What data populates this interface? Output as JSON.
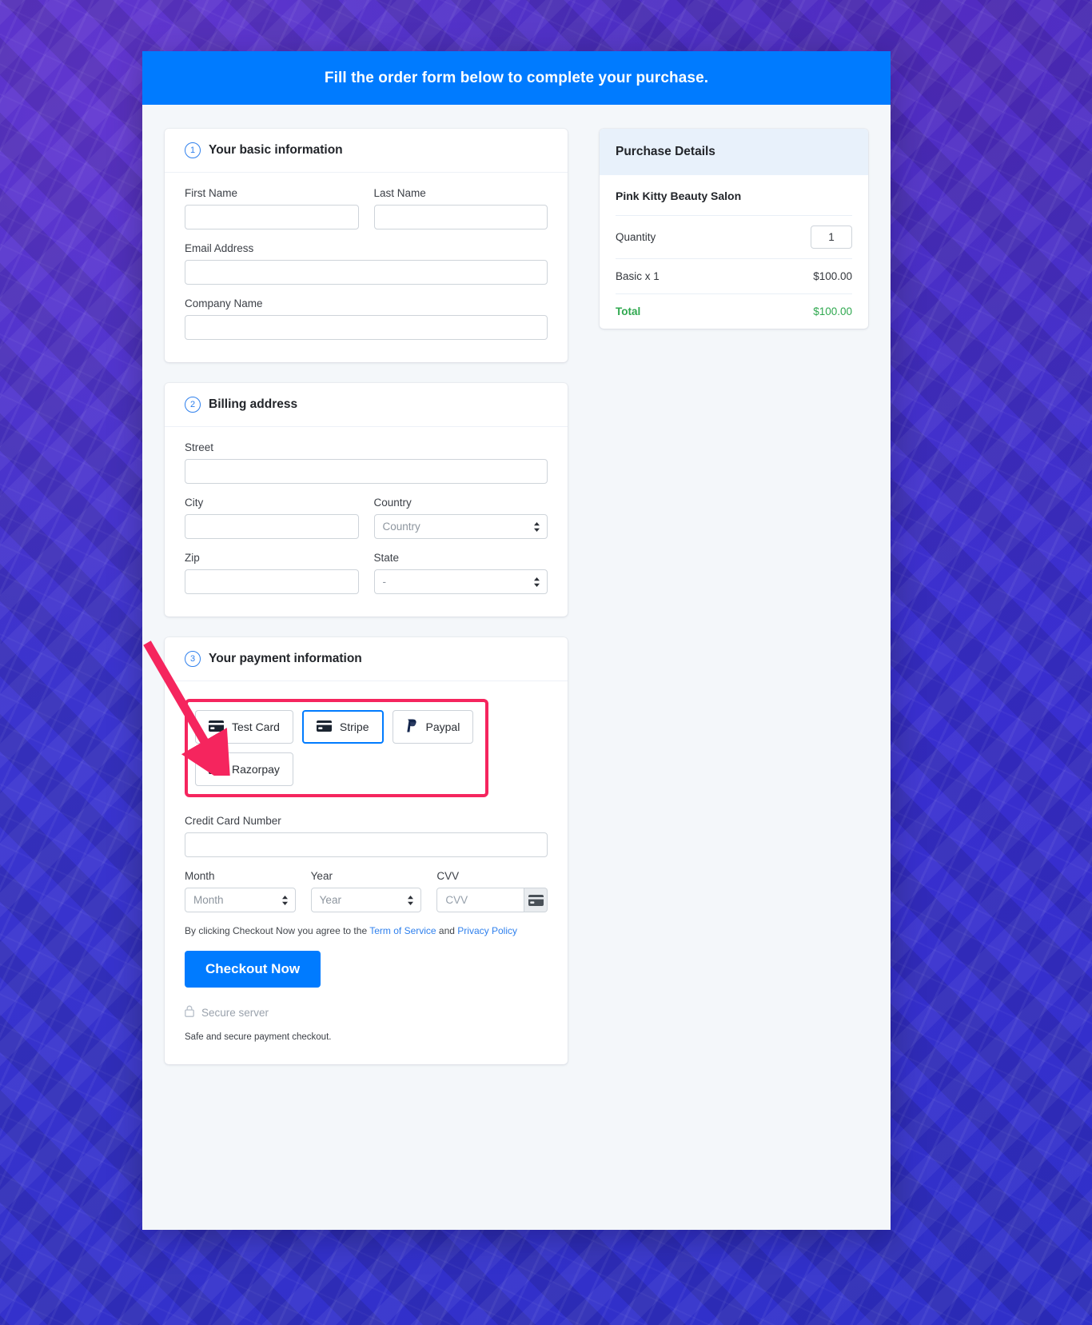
{
  "header": {
    "title": "Fill the order form below to complete your purchase."
  },
  "sections": [
    {
      "number": "1",
      "title": "Your basic information"
    },
    {
      "number": "2",
      "title": "Billing address"
    },
    {
      "number": "3",
      "title": "Your payment information"
    }
  ],
  "basic_info": {
    "first_name_label": "First Name",
    "first_name_value": "",
    "last_name_label": "Last Name",
    "last_name_value": "",
    "email_label": "Email Address",
    "email_value": "",
    "company_label": "Company Name",
    "company_value": ""
  },
  "billing": {
    "street_label": "Street",
    "street_value": "",
    "city_label": "City",
    "city_value": "",
    "country_label": "Country",
    "country_selected": "Country",
    "zip_label": "Zip",
    "zip_value": "",
    "state_label": "State",
    "state_selected": "-"
  },
  "payment": {
    "methods": [
      {
        "label": "Test Card",
        "icon": "credit-card-icon",
        "selected": false
      },
      {
        "label": "Stripe",
        "icon": "credit-card-icon",
        "selected": true
      },
      {
        "label": "Paypal",
        "icon": "paypal-icon",
        "selected": false
      },
      {
        "label": "Razorpay",
        "icon": "credit-card-icon",
        "selected": false
      }
    ],
    "card_number_label": "Credit Card Number",
    "card_number_value": "",
    "month_label": "Month",
    "month_selected": "Month",
    "year_label": "Year",
    "year_selected": "Year",
    "cvv_label": "CVV",
    "cvv_placeholder": "CVV",
    "cvv_addon_icon": "credit-card-icon",
    "terms_prefix": "By clicking Checkout Now you agree to the ",
    "terms_link1": "Term of Service",
    "terms_middle": " and ",
    "terms_link2": "Privacy Policy",
    "checkout_label": "Checkout Now",
    "secure_icon": "lock-icon",
    "secure_label": "Secure server",
    "safe_note": "Safe and secure payment checkout."
  },
  "purchase_details": {
    "title": "Purchase Details",
    "product": "Pink Kitty Beauty Salon",
    "quantity_label": "Quantity",
    "quantity_value": "1",
    "line_item_label": "Basic x 1",
    "line_item_price": "$100.00",
    "total_label": "Total",
    "total_price": "$100.00"
  },
  "colors": {
    "accent": "#007bff",
    "total_green": "#2fa84f",
    "highlight_red": "#f5255e",
    "panel_blue": "#e8f1fb"
  }
}
